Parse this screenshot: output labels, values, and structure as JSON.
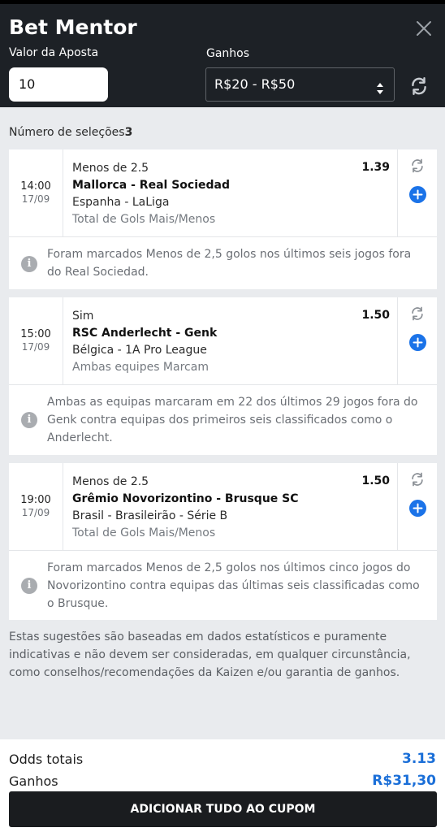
{
  "header": {
    "title": "Bet Mentor",
    "stake_label": "Valor da Aposta",
    "stake_value": "10",
    "winnings_label": "Ganhos",
    "winnings_range": "R$20 - R$50"
  },
  "selection_count_label": "Número de seleções",
  "selection_count": "3",
  "selections": [
    {
      "time": "14:00",
      "date": "17/09",
      "market": "Menos de 2.5",
      "match": "Mallorca - Real Sociedad",
      "league": "Espanha - LaLiga",
      "bet_type": "Total de Gols Mais/Menos",
      "odds": "1.39",
      "note": "Foram marcados Menos de 2,5 golos nos últimos seis jogos fora do Real Sociedad."
    },
    {
      "time": "15:00",
      "date": "17/09",
      "market": "Sim",
      "match": "RSC Anderlecht - Genk",
      "league": "Bélgica - 1A Pro League",
      "bet_type": "Ambas equipes Marcam",
      "odds": "1.50",
      "note": "Ambas as equipas marcaram em 22 dos últimos 29 jogos fora do Genk contra equipas dos primeiros seis classificados como o Anderlecht."
    },
    {
      "time": "19:00",
      "date": "17/09",
      "market": "Menos de 2.5",
      "match": "Grêmio Novorizontino - Brusque SC",
      "league": "Brasil - Brasileirão - Série B",
      "bet_type": "Total de Gols Mais/Menos",
      "odds": "1.50",
      "note": "Foram marcados Menos de 2,5 golos nos últimos cinco jogos do Novorizontino contra equipas das últimas seis classificadas como o Brusque."
    }
  ],
  "disclaimer": "Estas sugestões são baseadas em dados estatísticos e puramente indicativas e não devem ser consideradas, em qualquer circunstância, como conselhos/recomendações da Kaizen e/ou garantia de ganhos.",
  "footer": {
    "total_odds_label": "Odds totais",
    "total_odds": "3.13",
    "winnings_label": "Ganhos",
    "winnings": "R$31,30",
    "cta_label": "ADICIONAR TUDO AO CUPOM"
  },
  "colors": {
    "accent": "#1b73e8",
    "header_bg": "#1d2126",
    "cta_bg": "#1a1c1f"
  },
  "icons": [
    "close-icon",
    "caret-updown-icon",
    "refresh-icon",
    "plus-circle-icon",
    "info-icon"
  ]
}
